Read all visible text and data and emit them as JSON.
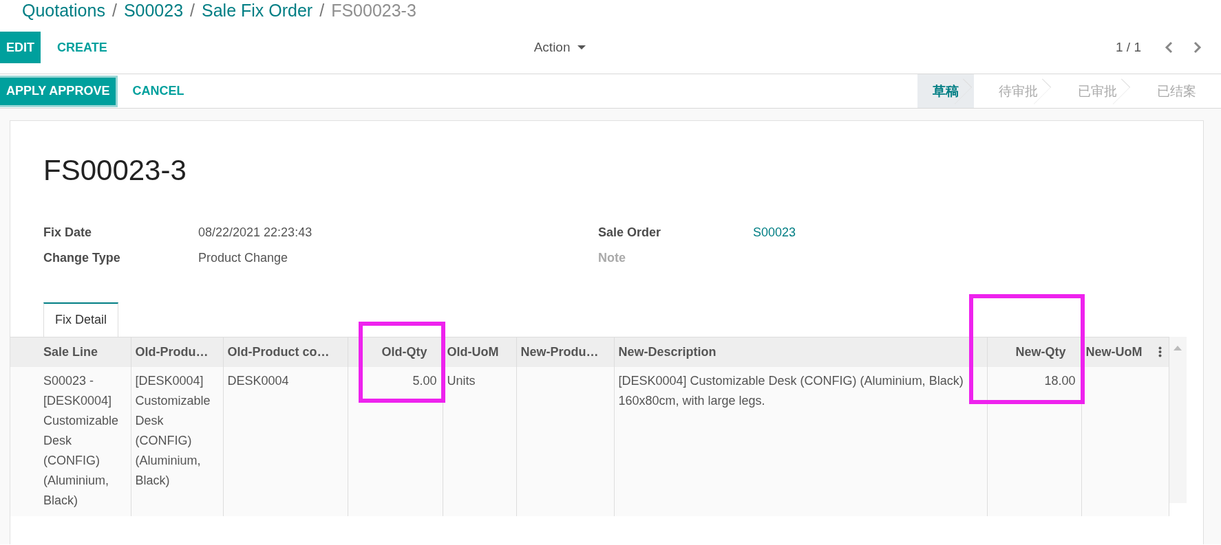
{
  "breadcrumbs": [
    {
      "label": "Quotations",
      "kind": "link"
    },
    {
      "label": "/",
      "kind": "separator"
    },
    {
      "label": "S00023",
      "kind": "link"
    },
    {
      "label": "/",
      "kind": "separator"
    },
    {
      "label": "Sale Fix Order",
      "kind": "link"
    },
    {
      "label": "/",
      "kind": "separator"
    },
    {
      "label": "FS00023-3",
      "kind": "current"
    }
  ],
  "toolbar": {
    "buttons": [
      {
        "label": "EDIT",
        "kind": "primary"
      },
      {
        "label": "CREATE",
        "kind": "link"
      }
    ],
    "action": "Action",
    "pager": "1 / 1"
  },
  "header": {
    "buttons": [
      {
        "label": "APPLY APPROVE",
        "kind": "primary"
      },
      {
        "label": "CANCEL",
        "kind": "link"
      }
    ],
    "stages": [
      {
        "label": "草稿",
        "selected": true
      },
      {
        "label": "待审批",
        "selected": false
      },
      {
        "label": "已审批",
        "selected": false
      },
      {
        "label": "已结案",
        "selected": false
      }
    ]
  },
  "record": {
    "title": "FS00023-3",
    "fields": [
      {
        "label": "Fix Date",
        "value": "08/22/2021 22:23:43",
        "kind": "text"
      },
      {
        "label": "Sale Order",
        "value": "S00023",
        "kind": "link"
      },
      {
        "label": "Change Type",
        "value": "Product Change",
        "kind": "text"
      },
      {
        "label": "Note",
        "kind": "empty"
      }
    ]
  },
  "tabs": [
    {
      "label": "Fix Detail",
      "selected": true
    }
  ],
  "table": {
    "columns": [
      {
        "label": "Sale Line",
        "kind": "text",
        "highlighted": false
      },
      {
        "label": "Old-Produ…",
        "kind": "text",
        "highlighted": false
      },
      {
        "label": "Old-Product co…",
        "kind": "text",
        "highlighted": false
      },
      {
        "label": "Old-Qty",
        "kind": "number",
        "highlighted": true
      },
      {
        "label": "Old-UoM",
        "kind": "text",
        "highlighted": false
      },
      {
        "label": "New-Produ…",
        "kind": "text",
        "highlighted": false
      },
      {
        "label": "New-Description",
        "kind": "text",
        "highlighted": false
      },
      {
        "label": "New-Qty",
        "kind": "number",
        "highlighted": true
      },
      {
        "label": "New-UoM",
        "kind": "text",
        "highlighted": false
      }
    ],
    "rows": [
      {
        "cells": [
          "S00023 - [DESK0004] Customizable Desk (CONFIG) (Aluminium, Black)",
          "[DESK0004] Customizable Desk (CONFIG) (Aluminium, Black)",
          "DESK0004",
          "5.00",
          "Units",
          null,
          "[DESK0004] Customizable Desk (CONFIG) (Aluminium, Black) 160x80cm, with large legs.",
          "18.00",
          null
        ]
      }
    ]
  }
}
